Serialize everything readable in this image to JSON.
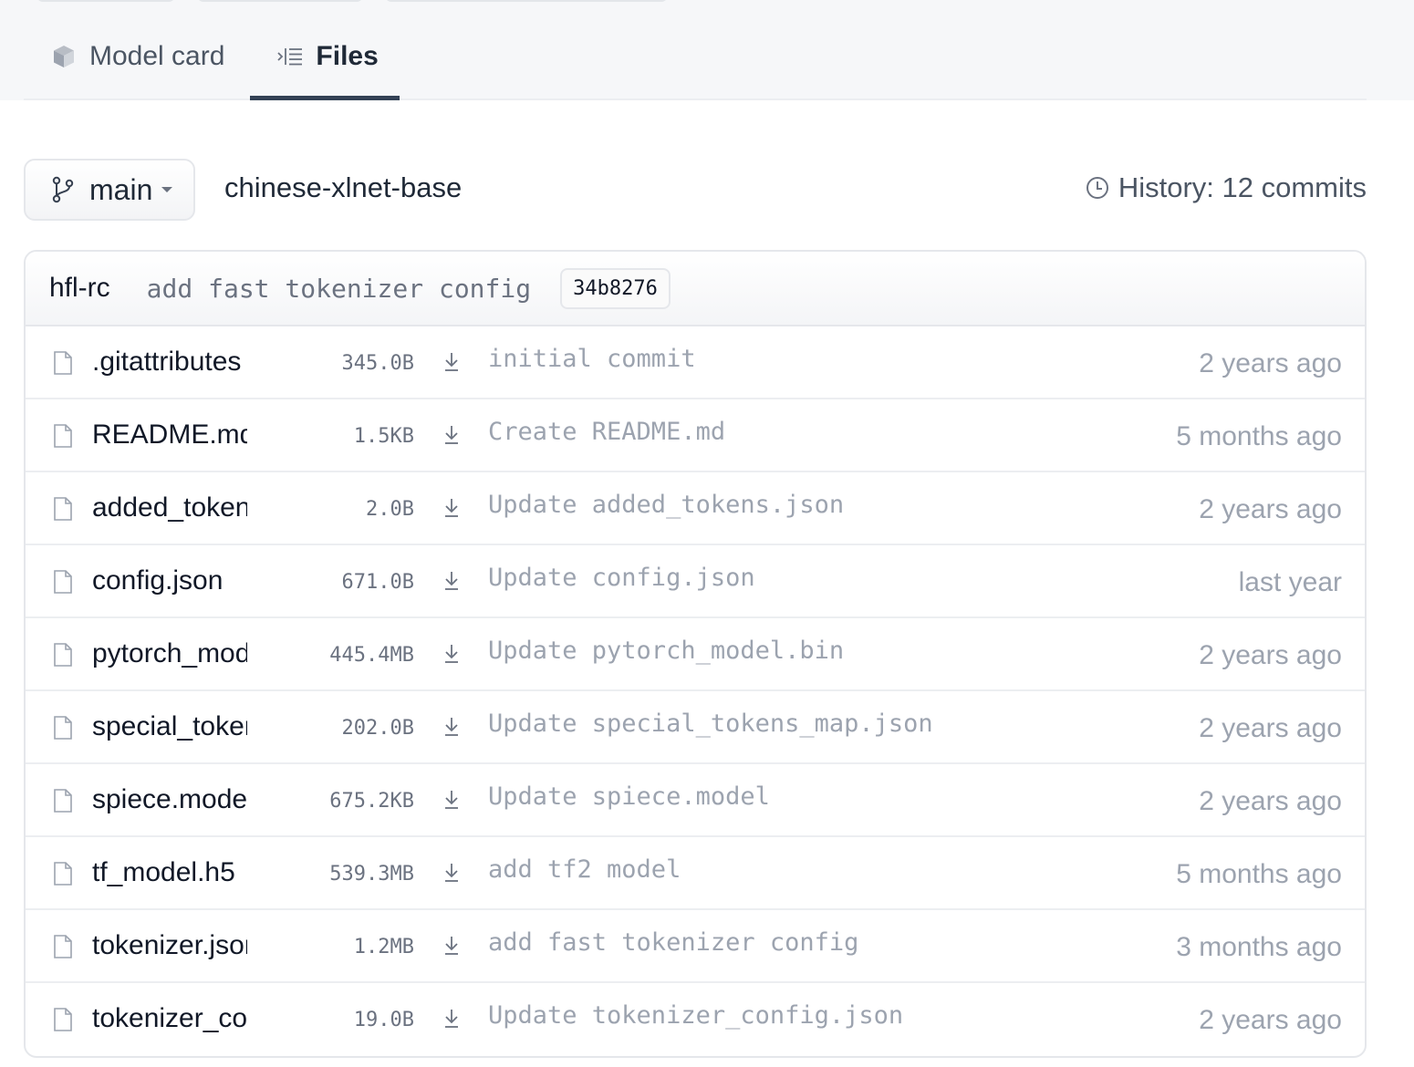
{
  "tabs": {
    "model_card": "Model card",
    "files": "Files"
  },
  "repo": {
    "branch": "main",
    "name": "chinese-xlnet-base",
    "history": "History: 12 commits"
  },
  "last_commit": {
    "author": "hfl-rc",
    "message": "add fast tokenizer config",
    "hash": "34b8276"
  },
  "files": [
    {
      "name": ".gitattributes",
      "size": "345.0B",
      "commit": "initial commit",
      "date": "2 years ago"
    },
    {
      "name": "README.md",
      "size": "1.5KB",
      "commit": "Create README.md",
      "date": "5 months ago"
    },
    {
      "name": "added_tokens.json",
      "size": "2.0B",
      "commit": "Update added_tokens.json",
      "date": "2 years ago"
    },
    {
      "name": "config.json",
      "size": "671.0B",
      "commit": "Update config.json",
      "date": "last year"
    },
    {
      "name": "pytorch_model.bin",
      "size": "445.4MB",
      "commit": "Update pytorch_model.bin",
      "date": "2 years ago"
    },
    {
      "name": "special_tokens_map.json",
      "size": "202.0B",
      "commit": "Update special_tokens_map.json",
      "date": "2 years ago"
    },
    {
      "name": "spiece.model",
      "size": "675.2KB",
      "commit": "Update spiece.model",
      "date": "2 years ago"
    },
    {
      "name": "tf_model.h5",
      "size": "539.3MB",
      "commit": "add tf2 model",
      "date": "5 months ago"
    },
    {
      "name": "tokenizer.json",
      "size": "1.2MB",
      "commit": "add fast tokenizer config",
      "date": "3 months ago"
    },
    {
      "name": "tokenizer_config.json",
      "size": "19.0B",
      "commit": "Update tokenizer_config.json",
      "date": "2 years ago"
    }
  ],
  "icons": {
    "model_card": "cube-icon",
    "files": "file-tree-icon",
    "branch": "git-branch-icon",
    "history": "clock-icon",
    "file": "file-icon",
    "download": "download-icon"
  },
  "colors": {
    "accent_underline": "#334155",
    "muted_text": "#9ca3af",
    "header_bg": "#f6f7f9"
  }
}
